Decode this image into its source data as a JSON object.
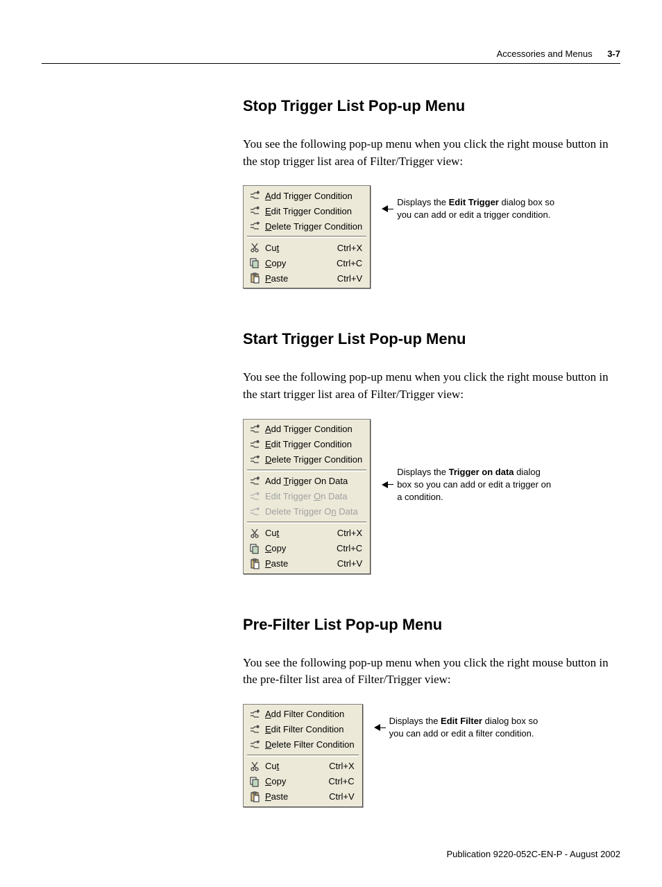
{
  "header": {
    "title": "Accessories and Menus",
    "page": "3-7"
  },
  "sections": [
    {
      "heading": "Stop Trigger List Pop-up Menu",
      "body": "You see the following pop-up menu when you click the right mouse button in the stop trigger list area of Filter/Trigger view:",
      "callout": {
        "pre": "Displays the ",
        "bold": "Edit Trigger",
        "post": " dialog box so you can add or edit a trigger condition.",
        "align_index": 1
      },
      "menu": [
        {
          "type": "item",
          "icon": "add",
          "pre": "",
          "hot": "A",
          "post": "dd Trigger Condition"
        },
        {
          "type": "item",
          "icon": "edit",
          "pre": "",
          "hot": "E",
          "post": "dit Trigger Condition"
        },
        {
          "type": "item",
          "icon": "delete",
          "pre": "",
          "hot": "D",
          "post": "elete Trigger Condition"
        },
        {
          "type": "sep"
        },
        {
          "type": "item",
          "icon": "cut",
          "pre": "Cu",
          "hot": "t",
          "post": "",
          "accel": "Ctrl+X"
        },
        {
          "type": "item",
          "icon": "copy",
          "pre": "",
          "hot": "C",
          "post": "opy",
          "accel": "Ctrl+C"
        },
        {
          "type": "item",
          "icon": "paste",
          "pre": "",
          "hot": "P",
          "post": "aste",
          "accel": "Ctrl+V"
        }
      ]
    },
    {
      "heading": "Start Trigger List Pop-up Menu",
      "body": "You see the following pop-up menu when you click the right mouse button in the start trigger list area of Filter/Trigger view:",
      "callout": {
        "pre": "Displays the ",
        "bold": "Trigger on data",
        "post": " dialog box so you can add or edit a trigger on a condition.",
        "align_index": 4
      },
      "menu": [
        {
          "type": "item",
          "icon": "add",
          "pre": "",
          "hot": "A",
          "post": "dd Trigger Condition"
        },
        {
          "type": "item",
          "icon": "edit",
          "pre": "",
          "hot": "E",
          "post": "dit Trigger Condition"
        },
        {
          "type": "item",
          "icon": "delete",
          "pre": "",
          "hot": "D",
          "post": "elete Trigger Condition"
        },
        {
          "type": "sep"
        },
        {
          "type": "item",
          "icon": "add",
          "pre": "Add ",
          "hot": "T",
          "post": "rigger On Data"
        },
        {
          "type": "item",
          "icon": "edit",
          "pre": "Edit Trigger ",
          "hot": "O",
          "post": "n Data",
          "disabled": true
        },
        {
          "type": "item",
          "icon": "delete",
          "pre": "Delete Trigger O",
          "hot": "n",
          "post": " Data",
          "disabled": true
        },
        {
          "type": "sep"
        },
        {
          "type": "item",
          "icon": "cut",
          "pre": "Cu",
          "hot": "t",
          "post": "",
          "accel": "Ctrl+X"
        },
        {
          "type": "item",
          "icon": "copy",
          "pre": "",
          "hot": "C",
          "post": "opy",
          "accel": "Ctrl+C"
        },
        {
          "type": "item",
          "icon": "paste",
          "pre": "",
          "hot": "P",
          "post": "aste",
          "accel": "Ctrl+V"
        }
      ]
    },
    {
      "heading": "Pre-Filter List Pop-up Menu",
      "body": "You see the following pop-up menu when you click the right mouse button in the pre-filter list area of Filter/Trigger view:",
      "callout": {
        "pre": "Displays the ",
        "bold": "Edit Filter",
        "post": " dialog box so you can add or edit a filter condition.",
        "align_index": 1
      },
      "menu": [
        {
          "type": "item",
          "icon": "add",
          "pre": "",
          "hot": "A",
          "post": "dd Filter Condition"
        },
        {
          "type": "item",
          "icon": "edit",
          "pre": "",
          "hot": "E",
          "post": "dit Filter Condition"
        },
        {
          "type": "item",
          "icon": "delete",
          "pre": "",
          "hot": "D",
          "post": "elete Filter Condition"
        },
        {
          "type": "sep"
        },
        {
          "type": "item",
          "icon": "cut",
          "pre": "Cu",
          "hot": "t",
          "post": "",
          "accel": "Ctrl+X"
        },
        {
          "type": "item",
          "icon": "copy",
          "pre": "",
          "hot": "C",
          "post": "opy",
          "accel": "Ctrl+C"
        },
        {
          "type": "item",
          "icon": "paste",
          "pre": "",
          "hot": "P",
          "post": "aste",
          "accel": "Ctrl+V"
        }
      ]
    }
  ],
  "footer": "Publication 9220-052C-EN-P - August 2002"
}
